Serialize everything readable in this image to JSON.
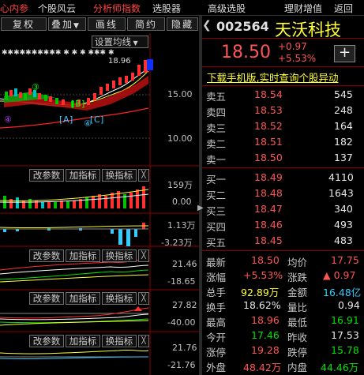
{
  "menu": [
    "心内参",
    "个股风云",
    "分析师指数",
    "选股器",
    "高级选股",
    "理财增值",
    "返回"
  ],
  "toolbar": {
    "b1": "复权",
    "b2": "叠加",
    "b3": "画线",
    "b4": "简约",
    "b5": "隐藏",
    "setting": "设置均线"
  },
  "chart": {
    "price_high_label": "18.96",
    "axis": {
      "p15": "15.00",
      "p10": "10.00"
    },
    "markers": {
      "m3": "③",
      "m4": "④",
      "m4b": "④",
      "boxA": "A",
      "boxB": "B",
      "boxC": "C"
    },
    "panels": [
      {
        "btn1": "改参数",
        "btn2": "加指标",
        "btn3": "换指标",
        "close": "╳",
        "top": "159万",
        "bottom": "0.00"
      },
      {
        "top": "1.13万",
        "bottom": "-3.23万"
      },
      {
        "btn1": "改参数",
        "btn2": "加指标",
        "btn3": "换指标",
        "close": "╳",
        "top": "21.46",
        "bottom": "-18.65"
      },
      {
        "btn1": "改参数",
        "btn2": "加指标",
        "btn3": "换指标",
        "close": "╳",
        "top": "27.82",
        "bottom": "-40.00"
      },
      {
        "btn1": "改参数",
        "btn2": "加指标",
        "btn3": "换指标",
        "close": "╳",
        "top": "21.76",
        "bottom": "-21.76"
      }
    ]
  },
  "quote": {
    "code": "002564",
    "name": "天沃科技",
    "price": "18.50",
    "change": "+0.97",
    "change_pct": "+5.53%",
    "add_icon": "+",
    "promo": "下载手机版,实时查询个股异动",
    "sell": [
      {
        "label": "卖五",
        "price": "18.54",
        "vol": "545"
      },
      {
        "label": "卖四",
        "price": "18.53",
        "vol": "248"
      },
      {
        "label": "卖三",
        "price": "18.52",
        "vol": "164"
      },
      {
        "label": "卖二",
        "price": "18.51",
        "vol": "182"
      },
      {
        "label": "卖一",
        "price": "18.50",
        "vol": "137"
      }
    ],
    "buy": [
      {
        "label": "买一",
        "price": "18.49",
        "vol": "4110"
      },
      {
        "label": "买二",
        "price": "18.48",
        "vol": "1643"
      },
      {
        "label": "买三",
        "price": "18.47",
        "vol": "340"
      },
      {
        "label": "买四",
        "price": "18.46",
        "vol": "493"
      },
      {
        "label": "买五",
        "price": "18.45",
        "vol": "483"
      }
    ],
    "stats": [
      {
        "l1": "最新",
        "v1": "18.50",
        "l2": "均价",
        "v2": "17.75"
      },
      {
        "l1": "涨幅",
        "v1": "+5.53%",
        "l2": "涨跌",
        "v2": "▲ 0.97"
      },
      {
        "l1": "总手",
        "v1": "92.89万",
        "l2": "金额",
        "v2": "16.48亿"
      },
      {
        "l1": "换手",
        "v1": "18.62%",
        "l2": "量比",
        "v2": "0.94"
      },
      {
        "l1": "最高",
        "v1": "18.96",
        "l2": "最低",
        "v2": "16.91"
      },
      {
        "l1": "今开",
        "v1": "17.46",
        "l2": "昨收",
        "v2": "17.53"
      },
      {
        "l1": "涨停",
        "v1": "19.28",
        "l2": "跌停",
        "v2": "15.78"
      },
      {
        "l1": "外盘",
        "v1": "48.42万",
        "l2": "内盘",
        "v2": "44.46万"
      }
    ]
  }
}
